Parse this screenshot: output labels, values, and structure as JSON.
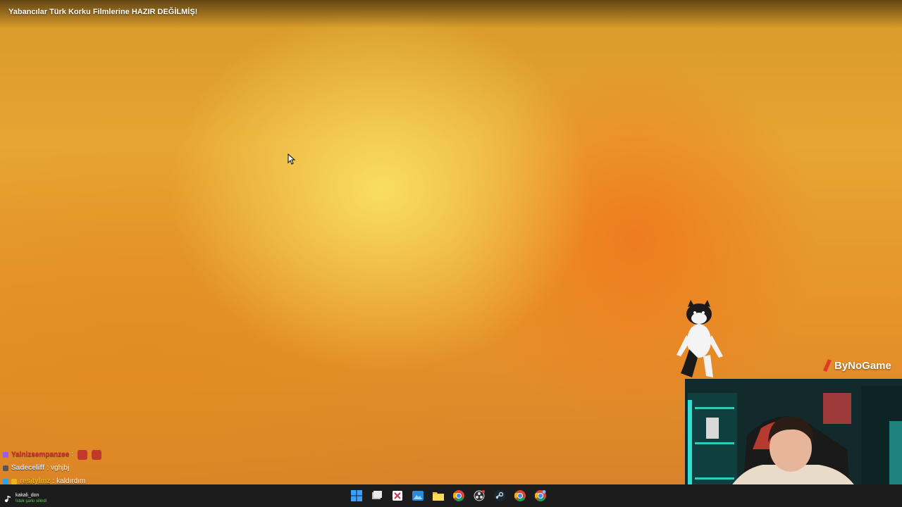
{
  "video": {
    "title": "Yabancılar Türk Korku Filmlerine HAZIR DEĞİLMİŞ!"
  },
  "overlay": {
    "logo_text": "ByNoGame"
  },
  "chat": {
    "messages": [
      {
        "user": "Yalnizsempanzee",
        "separator": ":",
        "text": "",
        "user_color": "#e0253a",
        "emotes": [
          "emote-1",
          "emote-2"
        ]
      },
      {
        "user": "Sadeceliff",
        "separator": ":",
        "text": "vghjbj",
        "user_color": "#cfe6ff",
        "emotes": []
      },
      {
        "user": "resitylmz",
        "separator": ":",
        "text": "kaldırdım",
        "user_color": "#e8b71c",
        "emotes": []
      }
    ]
  },
  "notification": {
    "user": "kakali_don",
    "subtitle": "İstek şarkı silindi"
  },
  "taskbar": {
    "icons": [
      "windows-start-icon",
      "task-view-icon",
      "snipping-tool-icon",
      "photos-icon",
      "file-explorer-icon",
      "chrome-icon",
      "obs-icon",
      "steam-icon",
      "chrome-profile-icon",
      "chrome-profile-2-icon"
    ]
  },
  "colors": {
    "taskbar": "#1c1c1c",
    "wallpaper_orange": "#e8951f",
    "wallpaper_yellow": "#f6d85a"
  }
}
